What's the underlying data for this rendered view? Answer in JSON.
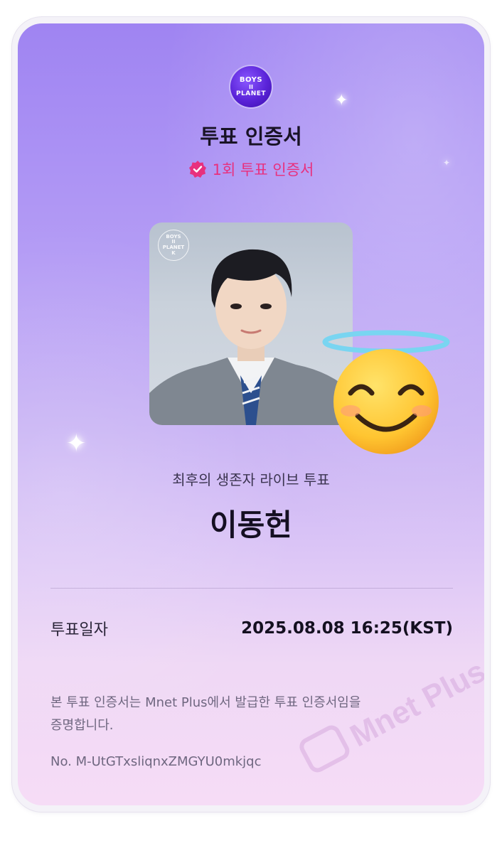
{
  "logo": {
    "line1": "BOYS",
    "line2": "II",
    "line3": "PLANET"
  },
  "certificate": {
    "title": "투표 인증서",
    "badge_label": "1회 투표 인증서",
    "subtitle": "최후의 생존자 라이브 투표",
    "candidate_name": "이동헌",
    "vote_date_label": "투표일자",
    "vote_date_value": "2025.08.08 16:25(KST)",
    "statement": "본 투표 인증서는 Mnet Plus에서 발급한 투표 인증서임을 증명합니다.",
    "serial_number": "No. M-UtGTxsliqnxZMGYU0mkjqc"
  },
  "photo": {
    "mini_logo": {
      "line1": "BOYS",
      "line2": "II",
      "line3": "PLANET",
      "line4": "K"
    }
  },
  "watermark_text": "Mnet Plus",
  "colors": {
    "badge_pink": "#e8307e",
    "logo_purple": "#5a23d8",
    "gradient_top": "#9f84f2",
    "gradient_bottom": "#f6dcf6"
  },
  "icons": {
    "badge": "verified-check-icon",
    "emoji": "smiling-face-with-halo-icon",
    "sparkle": "sparkle-icon"
  }
}
